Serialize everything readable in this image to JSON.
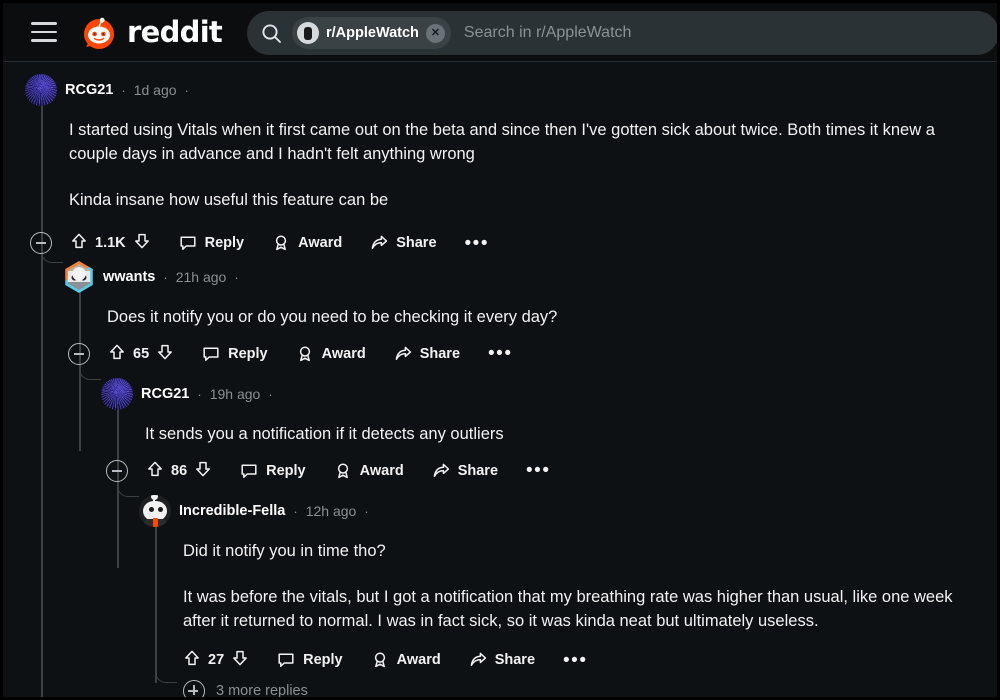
{
  "header": {
    "menu_icon": "hamburger-menu-icon",
    "logo_icon": "reddit-snoo-logo",
    "wordmark": "reddit",
    "search": {
      "icon": "search-icon",
      "subreddit_pill": "r/AppleWatch",
      "pill_avatar_icon": "applewatch-icon",
      "pill_close_icon": "close-icon",
      "placeholder": "Search in r/AppleWatch"
    }
  },
  "labels": {
    "reply": "Reply",
    "award": "Award",
    "share": "Share",
    "overflow": "•••",
    "separator": "·"
  },
  "colors": {
    "brand": "#ff4500",
    "page_bg": "#0e1113",
    "header_bg": "#0b0d0e",
    "search_bg": "#2a3236",
    "text": "#f2f2f2",
    "meta": "#8a8f94",
    "thread_line": "#3d4144"
  },
  "comments": [
    {
      "id": "c1",
      "author": "RCG21",
      "timestamp": "1d ago",
      "avatar": "swirl",
      "score": "1.1K",
      "collapsible": true,
      "paragraphs": [
        "I started using Vitals when it first came out on the beta and since then I've gotten sick about twice. Both times it knew a couple days in advance and I hadn't felt anything wrong",
        "Kinda insane how useful this feature can be"
      ]
    },
    {
      "id": "c2",
      "author": "wwants",
      "timestamp": "21h ago",
      "avatar": "hex",
      "score": "65",
      "collapsible": true,
      "paragraphs": [
        "Does it notify you or do you need to be checking it every day?"
      ]
    },
    {
      "id": "c3",
      "author": "RCG21",
      "timestamp": "19h ago",
      "avatar": "swirl",
      "score": "86",
      "collapsible": true,
      "paragraphs": [
        "It sends you a notification if it detects any outliers"
      ]
    },
    {
      "id": "c4",
      "author": "Incredible-Fella",
      "timestamp": "12h ago",
      "avatar": "snoo",
      "score": "27",
      "collapsible": false,
      "paragraphs": [
        "Did it notify you in time tho?",
        "It was before the vitals, but I got a notification that my breathing rate was higher than usual, like one week after it returned to normal. I was in fact sick, so it was kinda neat but ultimately useless."
      ]
    }
  ],
  "more_replies": {
    "label": "3 more replies",
    "icon": "plus-circle-icon"
  }
}
